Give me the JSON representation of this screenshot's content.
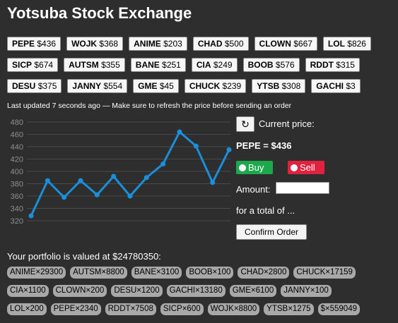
{
  "title": "Yotsuba Stock Exchange",
  "tickers": [
    [
      {
        "sym": "PEPE",
        "price": "$436"
      },
      {
        "sym": "WOJK",
        "price": "$368"
      },
      {
        "sym": "ANIME",
        "price": "$203"
      },
      {
        "sym": "CHAD",
        "price": "$500"
      },
      {
        "sym": "CLOWN",
        "price": "$667"
      },
      {
        "sym": "LOL",
        "price": "$826"
      }
    ],
    [
      {
        "sym": "SICP",
        "price": "$674"
      },
      {
        "sym": "AUTSM",
        "price": "$355"
      },
      {
        "sym": "BANE",
        "price": "$251"
      },
      {
        "sym": "CIA",
        "price": "$249"
      },
      {
        "sym": "BOOB",
        "price": "$576"
      },
      {
        "sym": "RDDT",
        "price": "$315"
      }
    ],
    [
      {
        "sym": "DESU",
        "price": "$375"
      },
      {
        "sym": "JANNY",
        "price": "$554"
      },
      {
        "sym": "GME",
        "price": "$45"
      },
      {
        "sym": "CHUCK",
        "price": "$239"
      },
      {
        "sym": "YTSB",
        "price": "$308"
      },
      {
        "sym": "GACHI",
        "price": "$3"
      }
    ]
  ],
  "status": "Last updated 7 seconds ago — Make sure to refresh the price before sending an order",
  "trade": {
    "refresh_icon": "refresh-icon",
    "current_label": "Current price:",
    "pair": "PEPE = $436",
    "buy_label": "Buy",
    "sell_label": "Sell",
    "buy_color": "#1ea84c",
    "sell_color": "#e0213f",
    "amount_label": "Amount:",
    "amount_value": "",
    "total_label": "for a total of ...",
    "confirm_label": "Confirm Order"
  },
  "portfolio": {
    "label": "Your portfolio is valued at $24780350:",
    "rows": [
      [
        "ANIME×29300",
        "AUTSM×8800",
        "BANE×3100",
        "BOOB×100",
        "CHAD×2800",
        "CHUCK×17159"
      ],
      [
        "CIA×1100",
        "CLOWN×200",
        "DESU×1200",
        "GACHI×13180",
        "GME×6100",
        "JANNY×100"
      ],
      [
        "LOL×200",
        "PEPE×2340",
        "RDDT×7508",
        "SICP×600",
        "WOJK×8800",
        "YTSB×1275",
        "$×559049"
      ]
    ]
  },
  "chart_data": {
    "type": "line",
    "title": "",
    "xlabel": "",
    "ylabel": "",
    "ylim": [
      320,
      480
    ],
    "yticks": [
      320,
      340,
      360,
      380,
      400,
      420,
      440,
      460,
      480
    ],
    "grid": true,
    "color": "#1a8fdc",
    "series": [
      {
        "values": [
          328,
          385,
          358,
          385,
          362,
          392,
          360,
          390,
          412,
          464,
          441,
          382,
          435
        ]
      }
    ]
  }
}
